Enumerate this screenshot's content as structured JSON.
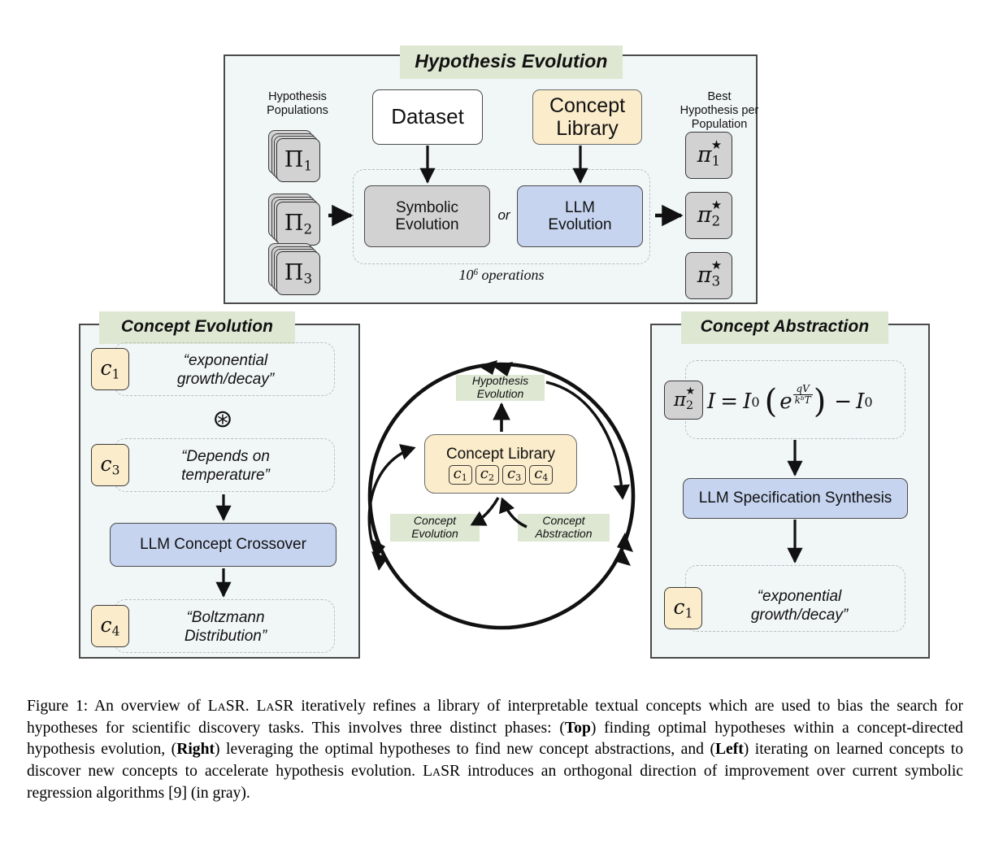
{
  "figure": {
    "panels": {
      "top": {
        "title": "Hypothesis Evolution",
        "left_label": "Hypothesis\nPopulations",
        "right_label": "Best\nHypothesis per\nPopulation",
        "dataset_box": "Dataset",
        "concept_library_box": "Concept\nLibrary",
        "symbolic_box": "Symbolic\nEvolution",
        "llm_box": "LLM\nEvolution",
        "or_label": "or",
        "operations_label": "10⁶ operations",
        "populations": [
          {
            "symbol": "Π",
            "index": "1"
          },
          {
            "symbol": "Π",
            "index": "2"
          },
          {
            "symbol": "Π",
            "index": "3"
          }
        ],
        "best_hypotheses": [
          {
            "symbol": "π",
            "index": "1",
            "mark": "★"
          },
          {
            "symbol": "π",
            "index": "2",
            "mark": "★"
          },
          {
            "symbol": "π",
            "index": "3",
            "mark": "★"
          }
        ]
      },
      "left": {
        "title": "Concept Evolution",
        "rows": [
          {
            "token": "c",
            "index": "1",
            "text": "“exponential\ngrowth/decay”"
          },
          {
            "token": "c",
            "index": "3",
            "text": "“Depends on\ntemperature”"
          }
        ],
        "operator_symbol": "⊛",
        "process_box": "LLM Concept Crossover",
        "output": {
          "token": "c",
          "index": "4",
          "text": "“Boltzmann\nDistribution”"
        }
      },
      "right": {
        "title": "Concept Abstraction",
        "input_token": {
          "symbol": "π",
          "index": "2",
          "mark": "★"
        },
        "equation": "I = I₀ ( e^(qV / k_b T) ) − I₀",
        "equation_parts": {
          "lhs": "I",
          "eq": "=",
          "i0a": "I",
          "i0a_sub": "0",
          "e": "e",
          "frac_num": "qV",
          "frac_den": "kᵇT",
          "minus": "−",
          "i0b": "I",
          "i0b_sub": "0"
        },
        "process_box": "LLM Specification Synthesis",
        "output": {
          "token": "c",
          "index": "1",
          "text": "“exponential\ngrowth/decay”"
        }
      },
      "center": {
        "library_title": "Concept Library",
        "library_tokens": [
          {
            "token": "c",
            "index": "1"
          },
          {
            "token": "c",
            "index": "2"
          },
          {
            "token": "c",
            "index": "3"
          },
          {
            "token": "c",
            "index": "4"
          }
        ],
        "tag_top": "Hypothesis\nEvolution",
        "tag_left": "Concept\nEvolution",
        "tag_right": "Concept\nAbstraction"
      }
    },
    "caption": {
      "line1_a": "Figure 1: An overview of ",
      "lasr": "LaSR",
      "line1_b": ". ",
      "line1_c": " iteratively refines a library of interpretable textual concepts which are used to bias the search for hypotheses for scientific discovery tasks. This involves three distinct phases: (",
      "top_bold": "Top",
      "line2": ") finding optimal hypotheses within a concept-directed hypothesis evolution, (",
      "right_bold": "Right",
      "line3": ") leveraging the optimal hypotheses to find new concept abstractions, and (",
      "left_bold": "Left",
      "line4": ") iterating on learned concepts to discover new concepts to accelerate hypothesis evolution. ",
      "line5": " introduces an orthogonal direction of improvement over current symbolic regression algorithms [9] (in gray)."
    },
    "colors": {
      "panel_bg": "#f1f6f7",
      "panel_border": "#4a4a4a",
      "title_badge": "#dde7d2",
      "gray_node": "#d2d2d2",
      "blue_node": "#c6d4f0",
      "cream_node": "#fbeccb",
      "dashed_border": "#b9bec0"
    }
  }
}
